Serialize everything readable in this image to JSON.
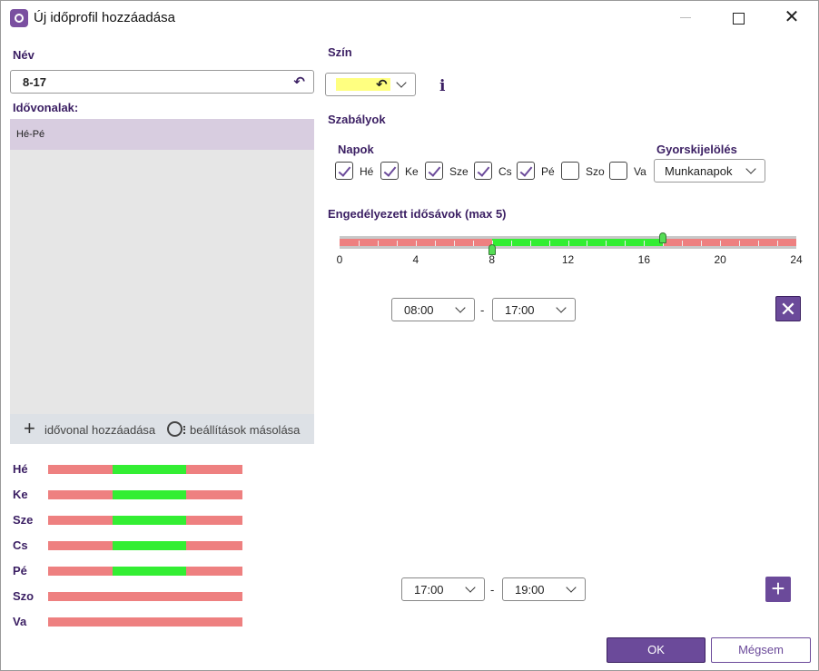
{
  "window": {
    "title": "Új időprofil hozzáadása",
    "close_glyph": "✕"
  },
  "left": {
    "name_label": "Név",
    "name_value": "8-17",
    "timelines_label": "Idővonalak:",
    "timelines": [
      {
        "label": "Hé-Pé",
        "selected": true
      }
    ],
    "add_timeline_label": "idővonal hozzáadása",
    "copy_settings_label": "beállítások másolása",
    "day_bars": [
      {
        "label": "Hé",
        "active": [
          8,
          17
        ]
      },
      {
        "label": "Ke",
        "active": [
          8,
          17
        ]
      },
      {
        "label": "Sze",
        "active": [
          8,
          17
        ]
      },
      {
        "label": "Cs",
        "active": [
          8,
          17
        ]
      },
      {
        "label": "Pé",
        "active": [
          8,
          17
        ]
      },
      {
        "label": "Szo",
        "active": null
      },
      {
        "label": "Va",
        "active": null
      }
    ]
  },
  "right": {
    "color_label": "Szín",
    "color_value": "#ffff80",
    "info_glyph": "i",
    "rules_label": "Szabályok",
    "days_label": "Napok",
    "quick_label": "Gyorskijelölés",
    "quick_value": "Munkanapok",
    "days": [
      {
        "label": "Hé",
        "checked": true
      },
      {
        "label": "Ke",
        "checked": true
      },
      {
        "label": "Sze",
        "checked": true
      },
      {
        "label": "Cs",
        "checked": true
      },
      {
        "label": "Pé",
        "checked": true
      },
      {
        "label": "Szo",
        "checked": false
      },
      {
        "label": "Va",
        "checked": false
      }
    ],
    "slots_label": "Engedélyezett idősávok (max 5)",
    "slider_ticks": [
      "0",
      "4",
      "8",
      "12",
      "16",
      "20",
      "24"
    ],
    "slider_range": [
      8,
      17
    ],
    "slot": {
      "from": "08:00",
      "to": "17:00",
      "dash": "-"
    },
    "new_slot": {
      "from": "17:00",
      "to": "19:00",
      "dash": "-"
    },
    "remove_glyph": "✕",
    "add_glyph": "+"
  },
  "footer": {
    "ok_label": "OK",
    "cancel_label": "Mégsem"
  },
  "colors": {
    "accent": "#6b4a9a",
    "label": "#3b1f63",
    "inactive": "#ee8080",
    "active": "#33ee33",
    "selection": "#d8cde0"
  }
}
